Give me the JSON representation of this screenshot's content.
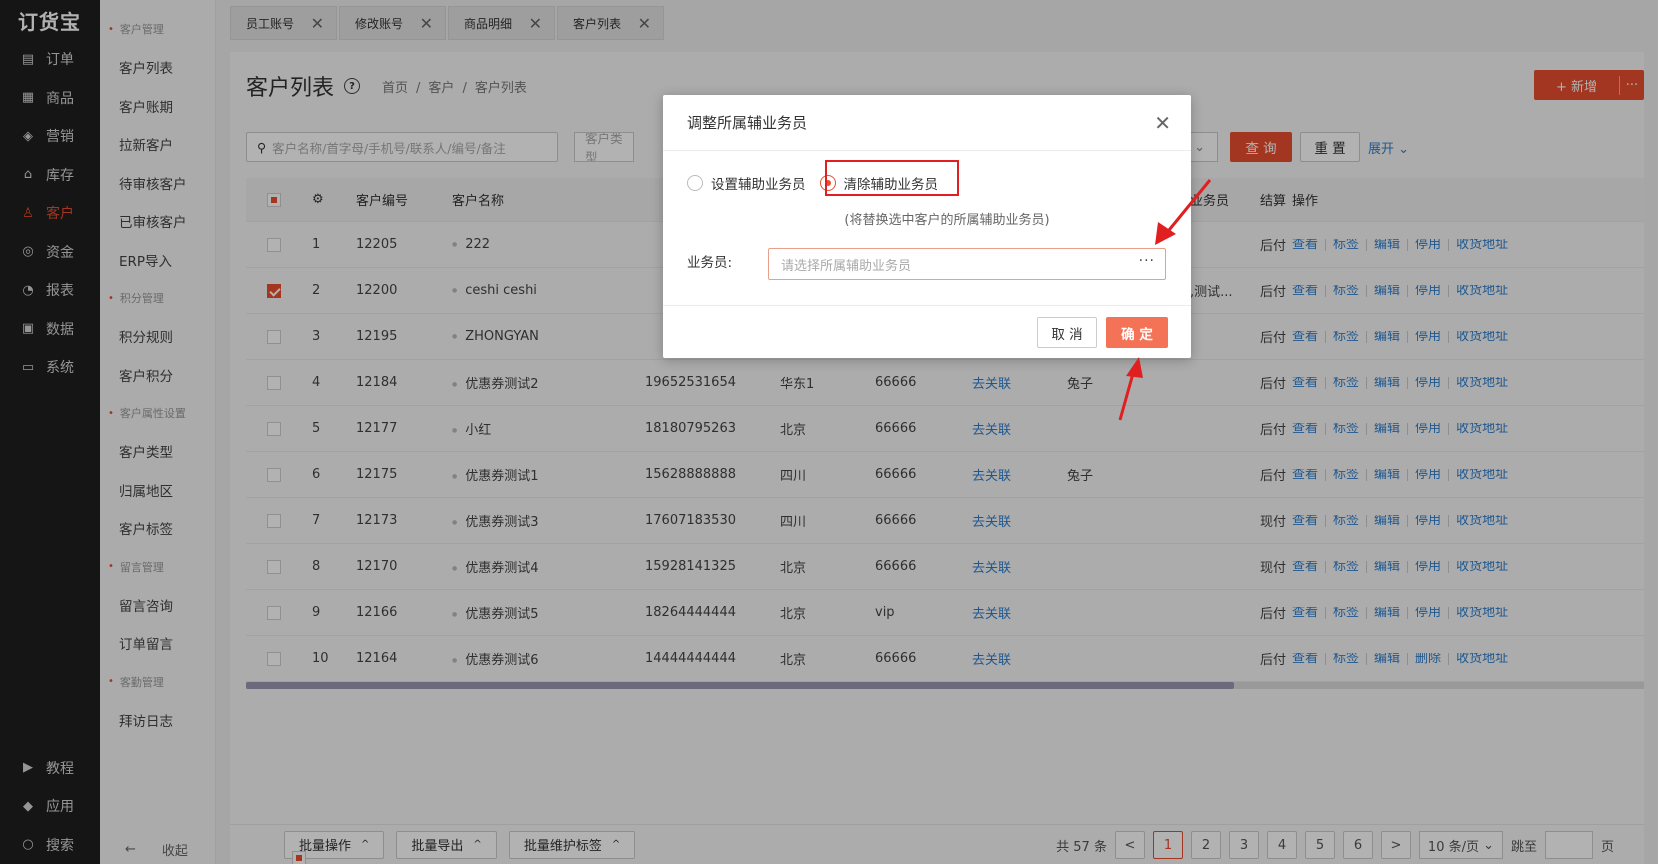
{
  "app": {
    "logo": "订货宝"
  },
  "nav": {
    "items": [
      {
        "label": "订单",
        "icon": "order-icon"
      },
      {
        "label": "商品",
        "icon": "product-icon"
      },
      {
        "label": "营销",
        "icon": "marketing-icon"
      },
      {
        "label": "库存",
        "icon": "warehouse-icon"
      },
      {
        "label": "客户",
        "icon": "customer-icon",
        "active": true
      },
      {
        "label": "资金",
        "icon": "money-icon"
      },
      {
        "label": "报表",
        "icon": "report-icon"
      },
      {
        "label": "数据",
        "icon": "data-icon"
      },
      {
        "label": "系统",
        "icon": "system-icon"
      }
    ],
    "bottom": [
      {
        "label": "教程",
        "icon": "tutorial-icon"
      },
      {
        "label": "应用",
        "icon": "apps-icon"
      },
      {
        "label": "搜索",
        "icon": "search-icon"
      }
    ]
  },
  "subnav": {
    "groups": [
      {
        "title": "客户管理",
        "items": [
          "客户列表",
          "客户账期",
          "拉新客户",
          "待审核客户",
          "已审核客户",
          "ERP导入"
        ]
      },
      {
        "title": "积分管理",
        "items": [
          "积分规则",
          "客户积分"
        ]
      },
      {
        "title": "客户属性设置",
        "items": [
          "客户类型",
          "归属地区",
          "客户标签"
        ]
      },
      {
        "title": "留言管理",
        "items": [
          "留言咨询",
          "订单留言"
        ]
      },
      {
        "title": "客勤管理",
        "items": [
          "拜访日志"
        ]
      }
    ],
    "collapse": "收起"
  },
  "tabs": [
    {
      "label": "员工账号"
    },
    {
      "label": "修改账号"
    },
    {
      "label": "商品明细"
    },
    {
      "label": "客户列表"
    }
  ],
  "page": {
    "title": "客户列表",
    "breadcrumb": [
      "首页",
      "/",
      "客户",
      "/",
      "客户列表"
    ],
    "new_button": "新增",
    "search_placeholder": "客户名称/首字母/手机号/联系人/编号/备注",
    "search2_placeholder": "客户类型",
    "query": "查 询",
    "reset": "重 置",
    "expand": "展开"
  },
  "table": {
    "headers": {
      "code": "客户编号",
      "name": "客户名称",
      "aux": "辅助业务员",
      "settle": "结算",
      "ops": "操作"
    },
    "rows": [
      {
        "no": "1",
        "code": "12205",
        "name": "222",
        "phone": "",
        "area": "",
        "grade": "",
        "rel": "",
        "sales": "",
        "aux": "",
        "settle": "后付",
        "ops": [
          "查看",
          "标签",
          "编辑",
          "停用",
          "收货地址"
        ],
        "checked": false
      },
      {
        "no": "2",
        "code": "12200",
        "name": "ceshi ceshi",
        "phone": "",
        "area": "",
        "grade": "",
        "rel": "",
        "sales": "",
        "aux": "兔子,测试...",
        "settle": "后付",
        "ops": [
          "查看",
          "标签",
          "编辑",
          "停用",
          "收货地址"
        ],
        "checked": true
      },
      {
        "no": "3",
        "code": "12195",
        "name": "ZHONGYAN",
        "phone": "",
        "area": "",
        "grade": "",
        "rel": "",
        "sales": "",
        "aux": "",
        "settle": "后付",
        "ops": [
          "查看",
          "标签",
          "编辑",
          "停用",
          "收货地址"
        ],
        "checked": false
      },
      {
        "no": "4",
        "code": "12184",
        "name": "优惠券测试2",
        "phone": "19652531654",
        "area": "华东1",
        "grade": "66666",
        "rel": "去关联",
        "sales": "兔子",
        "aux": "",
        "settle": "后付",
        "ops": [
          "查看",
          "标签",
          "编辑",
          "停用",
          "收货地址"
        ],
        "checked": false
      },
      {
        "no": "5",
        "code": "12177",
        "name": "小红",
        "phone": "18180795263",
        "area": "北京",
        "grade": "66666",
        "rel": "去关联",
        "sales": "",
        "aux": "",
        "settle": "后付",
        "ops": [
          "查看",
          "标签",
          "编辑",
          "停用",
          "收货地址"
        ],
        "checked": false
      },
      {
        "no": "6",
        "code": "12175",
        "name": "优惠券测试1",
        "phone": "15628888888",
        "area": "四川",
        "grade": "66666",
        "rel": "去关联",
        "sales": "兔子",
        "aux": "",
        "settle": "后付",
        "ops": [
          "查看",
          "标签",
          "编辑",
          "停用",
          "收货地址"
        ],
        "checked": false
      },
      {
        "no": "7",
        "code": "12173",
        "name": "优惠券测试3",
        "phone": "17607183530",
        "area": "四川",
        "grade": "66666",
        "rel": "去关联",
        "sales": "",
        "aux": "",
        "settle": "现付",
        "ops": [
          "查看",
          "标签",
          "编辑",
          "停用",
          "收货地址"
        ],
        "checked": false
      },
      {
        "no": "8",
        "code": "12170",
        "name": "优惠券测试4",
        "phone": "15928141325",
        "area": "北京",
        "grade": "66666",
        "rel": "去关联",
        "sales": "",
        "aux": "",
        "settle": "现付",
        "ops": [
          "查看",
          "标签",
          "编辑",
          "停用",
          "收货地址"
        ],
        "checked": false
      },
      {
        "no": "9",
        "code": "12166",
        "name": "优惠券测试5",
        "phone": "18264444444",
        "area": "北京",
        "grade": "vip",
        "rel": "去关联",
        "sales": "",
        "aux": "",
        "settle": "后付",
        "ops": [
          "查看",
          "标签",
          "编辑",
          "停用",
          "收货地址"
        ],
        "checked": false
      },
      {
        "no": "10",
        "code": "12164",
        "name": "优惠券测试6",
        "phone": "14444444444",
        "area": "北京",
        "grade": "66666",
        "rel": "去关联",
        "sales": "",
        "aux": "",
        "settle": "后付",
        "ops": [
          "查看",
          "标签",
          "编辑",
          "删除",
          "收货地址"
        ],
        "checked": false
      }
    ]
  },
  "bottombar": {
    "batch_ops": "批量操作",
    "batch_export": "批量导出",
    "batch_tags": "批量维护标签",
    "total": "共 57 条",
    "pages": [
      "1",
      "2",
      "3",
      "4",
      "5",
      "6"
    ],
    "page_size": "10 条/页",
    "jump_label": "跳至",
    "page_unit": "页"
  },
  "dialog": {
    "title": "调整所属辅业务员",
    "option_set": "设置辅助业务员",
    "option_clear": "清除辅助业务员",
    "selected_option": "clear",
    "hint": "(将替换选中客户的所属辅助业务员)",
    "field_label": "业务员:",
    "field_placeholder": "请选择所属辅助业务员",
    "cancel": "取 消",
    "confirm": "确 定"
  },
  "colors": {
    "accent": "#e84e2e",
    "link": "#2d7fcf",
    "annotation": "#e02020"
  }
}
